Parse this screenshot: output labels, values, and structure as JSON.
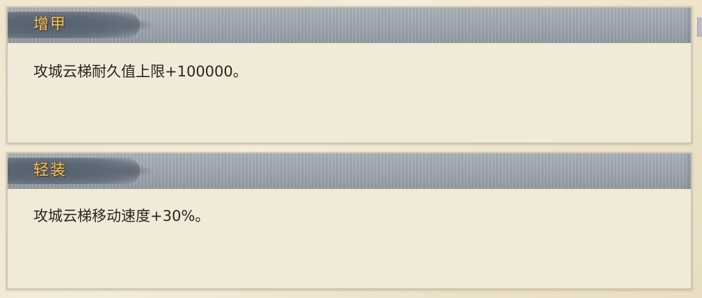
{
  "panels": [
    {
      "title": "增甲",
      "description": "攻城云梯耐久值上限+100000。"
    },
    {
      "title": "轻装",
      "description": "攻城云梯移动速度+30%。"
    }
  ],
  "colors": {
    "background": "#f1ead8",
    "header": "#9ea5ae",
    "title_text": "#f2c46a",
    "body_text": "#2a241c"
  }
}
